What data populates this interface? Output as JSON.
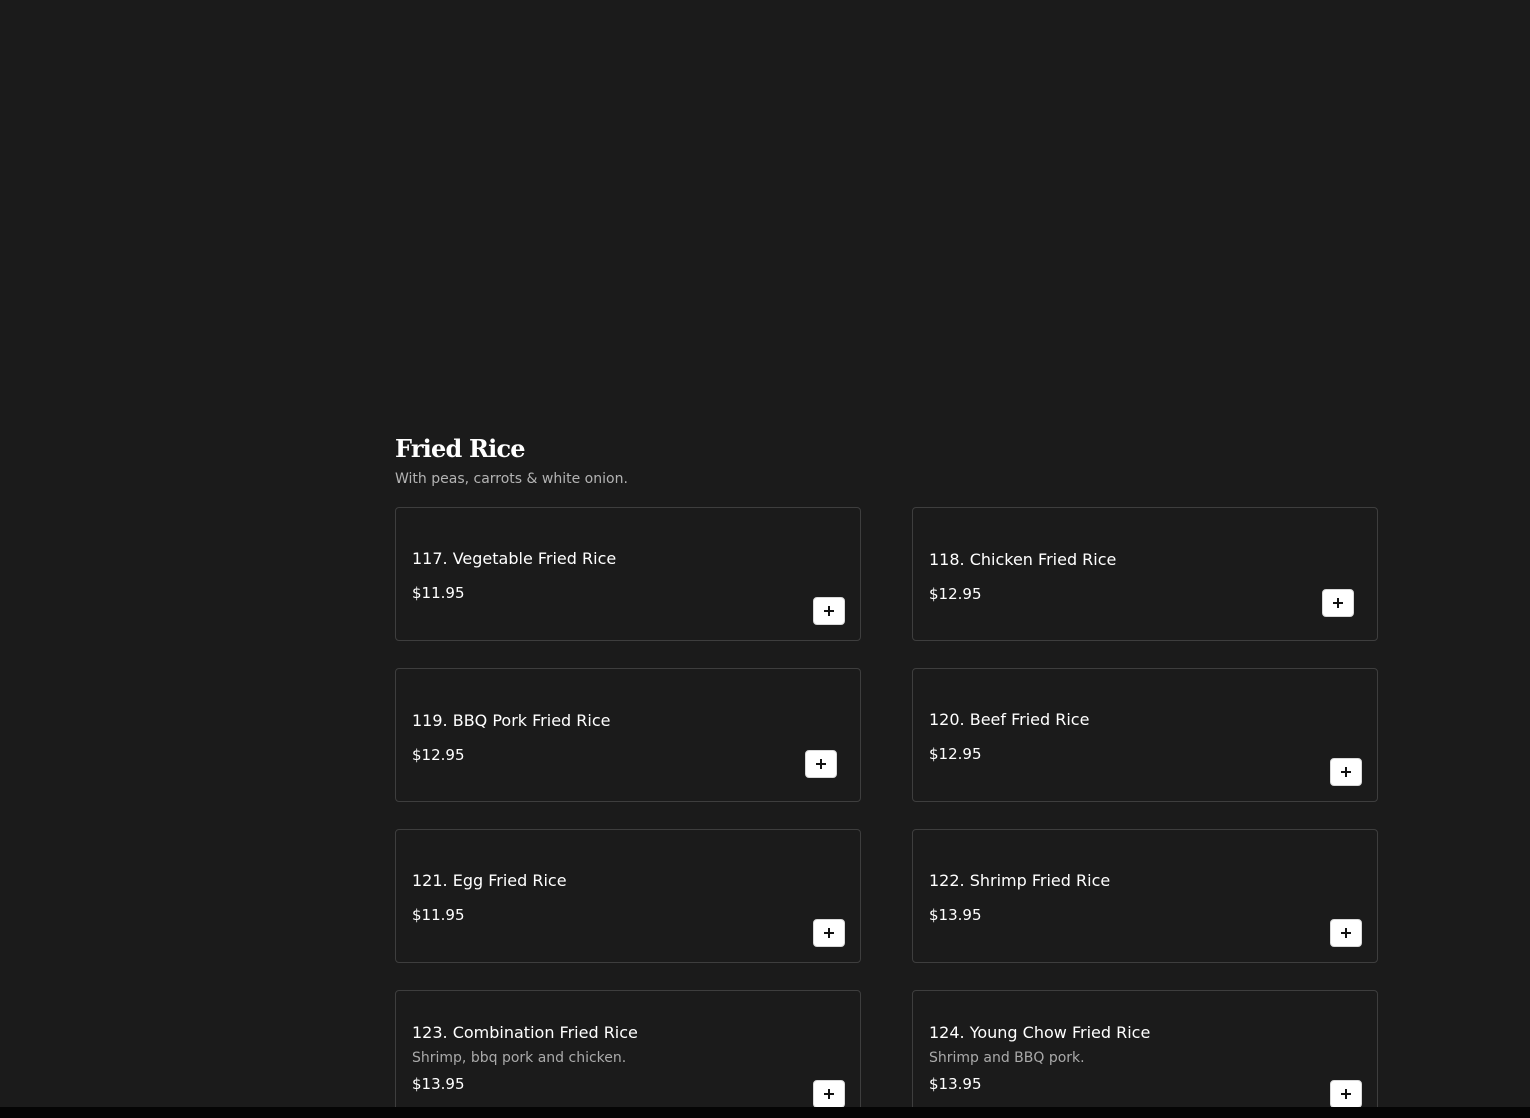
{
  "section": {
    "title": "Fried Rice",
    "description": "With peas, carrots & white onion."
  },
  "items": [
    {
      "name": "117. Vegetable Fried Rice",
      "description": "",
      "price": "$11.95",
      "add_icon": "plus-icon"
    },
    {
      "name": "118. Chicken Fried Rice",
      "description": "",
      "price": "$12.95",
      "add_icon": "plus-icon"
    },
    {
      "name": "119. BBQ Pork Fried Rice",
      "description": "",
      "price": "$12.95",
      "add_icon": "plus-icon"
    },
    {
      "name": "120. Beef Fried Rice",
      "description": "",
      "price": "$12.95",
      "add_icon": "plus-icon"
    },
    {
      "name": "121. Egg Fried Rice",
      "description": "",
      "price": "$11.95",
      "add_icon": "plus-icon"
    },
    {
      "name": "122. Shrimp Fried Rice",
      "description": "",
      "price": "$13.95",
      "add_icon": "plus-icon"
    },
    {
      "name": "123. Combination Fried Rice",
      "description": "Shrimp, bbq pork and chicken.",
      "price": "$13.95",
      "add_icon": "plus-icon"
    },
    {
      "name": "124. Young Chow Fried Rice",
      "description": "Shrimp and BBQ pork.",
      "price": "$13.95",
      "add_icon": "plus-icon"
    }
  ],
  "colors": {
    "background": "#1b1b1b",
    "card_border": "#3e3e3e",
    "text": "#ffffff",
    "muted_text": "#b3b3b3",
    "button_bg": "#ffffff"
  }
}
